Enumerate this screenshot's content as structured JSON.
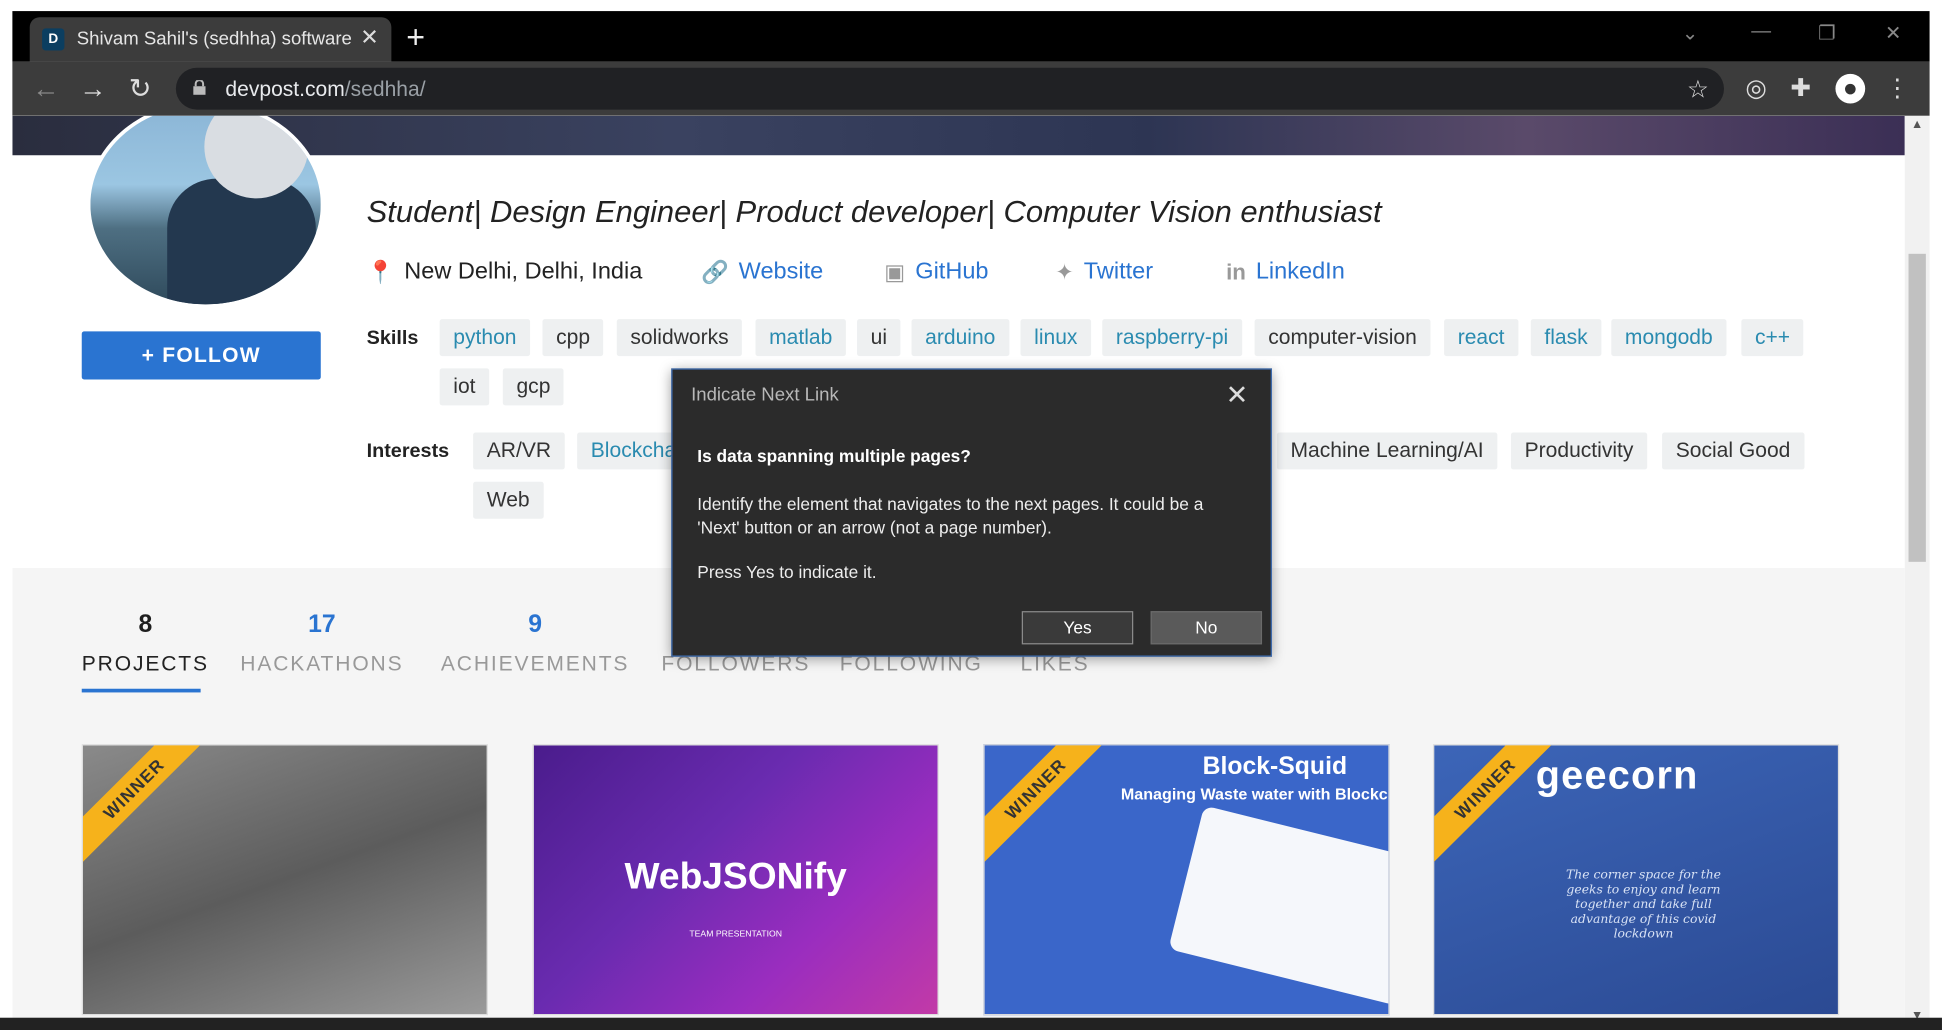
{
  "browser": {
    "tab_favicon": "D",
    "tab_title": "Shivam Sahil's (sedhha) software",
    "url_host": "devpost.com",
    "url_path": "/sedhha/"
  },
  "profile": {
    "follow_label": "+ FOLLOW",
    "tagline": "Student| Design Engineer| Product developer| Computer Vision enthusiast",
    "location": "New Delhi, Delhi, India",
    "links": {
      "website": "Website",
      "github": "GitHub",
      "twitter": "Twitter",
      "linkedin": "LinkedIn"
    },
    "skills_label": "Skills",
    "skills": [
      "python",
      "cpp",
      "solidworks",
      "matlab",
      "ui",
      "arduino",
      "linux",
      "raspberry-pi",
      "computer-vision",
      "react",
      "flask",
      "mongodb",
      "c++",
      "iot",
      "gcp"
    ],
    "interests_label": "Interests",
    "interests": [
      "AR/VR",
      "Blockchain",
      "Machine Learning/AI",
      "Productivity",
      "Social Good",
      "Web"
    ]
  },
  "stats": [
    {
      "num": "8",
      "label": "PROJECTS"
    },
    {
      "num": "17",
      "label": "HACKATHONS"
    },
    {
      "num": "9",
      "label": "ACHIEVEMENTS"
    },
    {
      "num": "",
      "label": "FOLLOWERS"
    },
    {
      "num": "",
      "label": "FOLLOWING"
    },
    {
      "num": "",
      "label": "LIKES"
    }
  ],
  "projects": {
    "ribbon": "WINNER",
    "card2_title": "WebJSONify",
    "card2_sub": "TEAM PRESENTATION",
    "card3_title": "Block-Squid",
    "card3_sub": "Managing Waste water with Blockch",
    "card4_logo": "geecorn",
    "card4_desc": "The corner space for the geeks to enjoy and learn together and take full advantage of this covid lockdown"
  },
  "dialog": {
    "title": "Indicate Next Link",
    "question": "Is data spanning multiple pages?",
    "body": "Identify the element that navigates to the next pages. It could be a 'Next' button or an arrow (not a page number).",
    "press": "Press Yes to indicate it.",
    "yes": "Yes",
    "no": "No"
  }
}
